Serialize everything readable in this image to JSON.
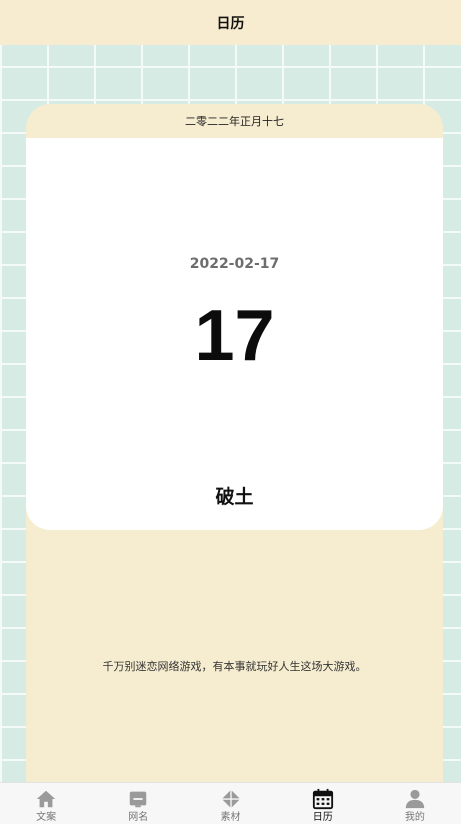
{
  "header": {
    "title": "日历"
  },
  "calendar": {
    "lunar_date": "二零二二年正月十七",
    "date": "2022-02-17",
    "day": "17",
    "solar_term": "破土",
    "quote": "千万别迷恋网络游戏，有本事就玩好人生这场大游戏。"
  },
  "tabbar": {
    "active": "日历",
    "items": [
      {
        "label": "文案",
        "icon": "home-icon"
      },
      {
        "label": "网名",
        "icon": "id-card-icon"
      },
      {
        "label": "素材",
        "icon": "diamond-icon"
      },
      {
        "label": "日历",
        "icon": "calendar-icon"
      },
      {
        "label": "我的",
        "icon": "user-icon"
      }
    ]
  },
  "colors": {
    "header_bg": "#f7eccf",
    "card_bg": "#ffffff",
    "grid_bg": "#d5ebe4",
    "active_tab": "#111111",
    "inactive_tab": "#777777"
  }
}
